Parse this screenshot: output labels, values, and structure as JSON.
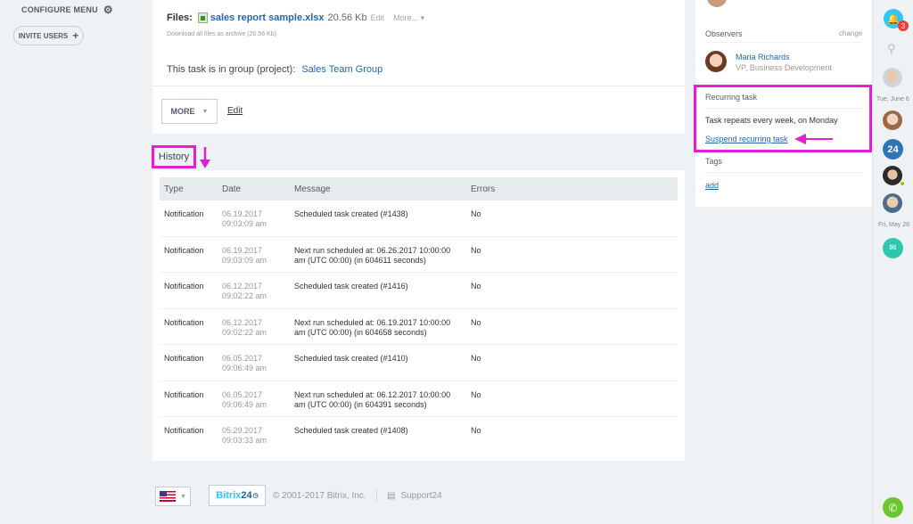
{
  "left_menu": {
    "configure_menu": "CONFIGURE MENU",
    "invite_users": "INVITE USERS"
  },
  "task": {
    "files_label": "Files:",
    "file_name": "sales report sample.xlsx",
    "file_size": "20.56 Kb",
    "file_edit": "Edit",
    "file_more": "More... ▾",
    "download_all": "Download all files as archive (20.56 Kb)",
    "group_label": "This task is in group (project):",
    "group_name": "Sales Team Group",
    "more_button": "MORE",
    "edit_link": "Edit"
  },
  "history": {
    "title": "History",
    "columns": [
      "Type",
      "Date",
      "Message",
      "Errors"
    ],
    "rows": [
      {
        "type": "Notification",
        "date": "06.19.2017",
        "time": "09:03:09 am",
        "message": "Scheduled task created (#1438)",
        "message2": "",
        "errors": "No"
      },
      {
        "type": "Notification",
        "date": "06.19.2017",
        "time": "09:03:09 am",
        "message": "Next run scheduled at: 06.26.2017 10:00:00",
        "message2": "am (UTC 00:00) (in 604611 seconds)",
        "errors": "No"
      },
      {
        "type": "Notification",
        "date": "06.12.2017",
        "time": "09:02:22 am",
        "message": "Scheduled task created (#1416)",
        "message2": "",
        "errors": "No"
      },
      {
        "type": "Notification",
        "date": "06.12.2017",
        "time": "09:02:22 am",
        "message": "Next run scheduled at: 06.19.2017 10:00:00",
        "message2": "am (UTC 00:00) (in 604658 seconds)",
        "errors": "No"
      },
      {
        "type": "Notification",
        "date": "06.05.2017",
        "time": "09:06:49 am",
        "message": "Scheduled task created (#1410)",
        "message2": "",
        "errors": "No"
      },
      {
        "type": "Notification",
        "date": "06.05.2017",
        "time": "09:06:49 am",
        "message": "Next run scheduled at: 06.12.2017 10:00:00",
        "message2": "am (UTC 00:00) (in 604391 seconds)",
        "errors": "No"
      },
      {
        "type": "Notification",
        "date": "05.29.2017",
        "time": "09:03:33 am",
        "message": "Scheduled task created (#1408)",
        "message2": "",
        "errors": "No"
      }
    ]
  },
  "sidebar_right": {
    "observers_label": "Observers",
    "observers_change": "change",
    "observer_name": "Maria Richards",
    "observer_title": "VP, Business Development",
    "recurring_label": "Recurring task",
    "recurring_text": "Task repeats every week, on Monday",
    "suspend_link": "Suspend recurring task",
    "tags_label": "Tags",
    "tags_add": "add"
  },
  "right_bar": {
    "notification_count": "3",
    "date1": "Tue, June 6",
    "date2": "Fri, May 26",
    "b24_label": "24"
  },
  "footer": {
    "bitrix_a": "Bitrix",
    "bitrix_b": "24",
    "copyright": "© 2001-2017 Bitrix, Inc.",
    "support": "Support24"
  },
  "colors": {
    "highlight": "#e61ed6",
    "link": "#2067b0",
    "accent_blue": "#2fc7f7",
    "green": "#6cc72f"
  }
}
